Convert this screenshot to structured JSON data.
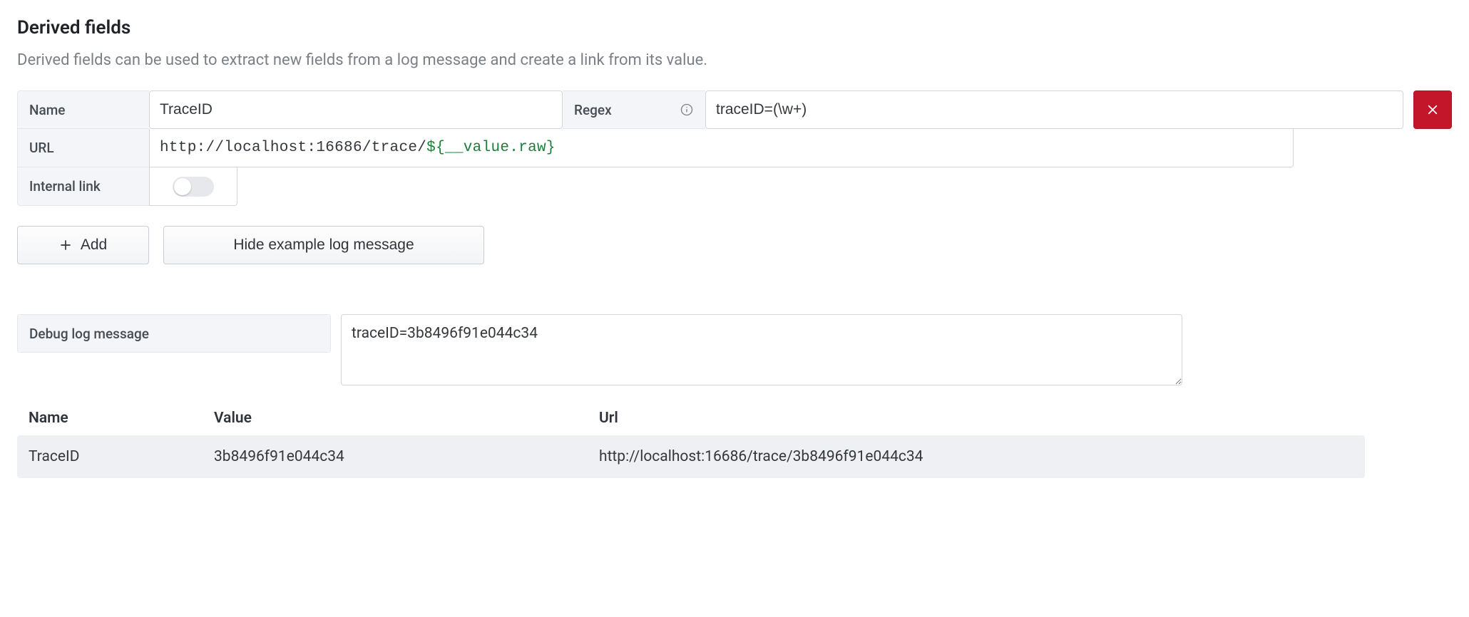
{
  "section": {
    "title": "Derived fields",
    "description": "Derived fields can be used to extract new fields from a log message and create a link from its value."
  },
  "labels": {
    "name": "Name",
    "regex": "Regex",
    "url": "URL",
    "internal_link": "Internal link",
    "debug_log_message": "Debug log message"
  },
  "field": {
    "name_value": "TraceID",
    "regex_value": "traceID=(\\w+)",
    "url_static": "http://localhost:16686/trace/",
    "url_template": "${__value.raw}",
    "internal_link_on": false
  },
  "buttons": {
    "add": "Add",
    "hide_example": "Hide example log message"
  },
  "debug": {
    "value": "traceID=3b8496f91e044c34"
  },
  "result_table": {
    "headers": {
      "name": "Name",
      "value": "Value",
      "url": "Url"
    },
    "row": {
      "name": "TraceID",
      "value": "3b8496f91e044c34",
      "url": "http://localhost:16686/trace/3b8496f91e044c34"
    }
  },
  "icons": {
    "info": "info-icon",
    "close": "close-icon",
    "plus": "plus-icon"
  }
}
